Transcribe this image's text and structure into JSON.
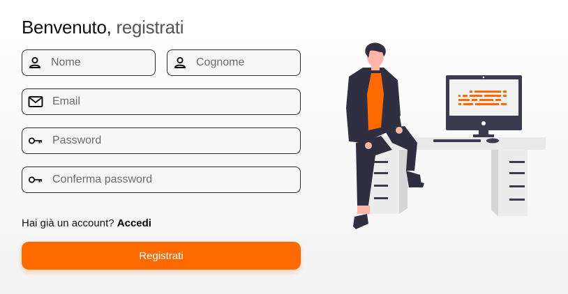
{
  "form": {
    "title_main": "Benvenuto,",
    "title_accent": " registrati",
    "fields": {
      "nome": {
        "placeholder": "Nome",
        "value": ""
      },
      "cognome": {
        "placeholder": "Cognome",
        "value": ""
      },
      "email": {
        "placeholder": "Email",
        "value": ""
      },
      "password": {
        "placeholder": "Password",
        "value": ""
      },
      "confirm_password": {
        "placeholder": "Conferma password",
        "value": ""
      }
    },
    "login_prompt": "Hai già un account?",
    "login_link": "Accedi",
    "submit_label": "Registrati",
    "icons": {
      "nome": "user-icon",
      "cognome": "user-icon",
      "email": "mail-icon",
      "password": "key-icon",
      "confirm_password": "key-icon"
    }
  },
  "colors": {
    "accent": "#ff6a00",
    "text": "#111111",
    "border": "#2a2a2a"
  },
  "illustration": {
    "name": "person-sitting-at-desk-illustration"
  }
}
